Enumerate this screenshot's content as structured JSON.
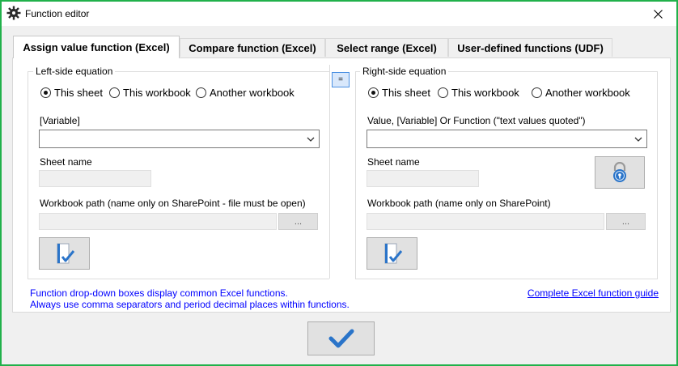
{
  "window": {
    "title": "Function editor"
  },
  "tabs": [
    {
      "label": "Assign value function (Excel)",
      "active": true
    },
    {
      "label": "Compare function (Excel)",
      "active": false
    },
    {
      "label": "Select range (Excel)",
      "active": false
    },
    {
      "label": "User-defined functions (UDF)",
      "active": false
    }
  ],
  "left": {
    "group_title": "Left-side equation",
    "scope_options": [
      {
        "label": "This sheet",
        "checked": true
      },
      {
        "label": "This workbook",
        "checked": false
      },
      {
        "label": "Another workbook",
        "checked": false
      }
    ],
    "variable_label": "[Variable]",
    "variable_value": "",
    "sheet_label": "Sheet name",
    "sheet_value": "",
    "workbook_label": "Workbook path (name only on SharePoint - file must be open)",
    "workbook_value": "",
    "browse_label": "..."
  },
  "equals_label": "=",
  "right": {
    "group_title": "Right-side equation",
    "scope_options": [
      {
        "label": "This sheet",
        "checked": true
      },
      {
        "label": "This workbook",
        "checked": false
      },
      {
        "label": "Another workbook",
        "checked": false
      }
    ],
    "value_label": "Value, [Variable] Or Function (\"text values quoted\")",
    "value_value": "",
    "sheet_label": "Sheet name",
    "sheet_value": "",
    "workbook_label": "Workbook path (name only on SharePoint)",
    "workbook_value": "",
    "browse_label": "..."
  },
  "notes": {
    "line1": "Function drop-down boxes display common Excel functions.",
    "line2": "Always use comma separators and period decimal places within functions.",
    "guide_link": "Complete Excel function guide"
  },
  "icons": {
    "title": "gear-icon",
    "close": "close-icon",
    "dropdown": "chevron-down-icon",
    "validate": "document-check-icon",
    "lock": "padlock-icon",
    "ok": "checkmark-icon"
  },
  "colors": {
    "window_border": "#21b14b",
    "link": "#0000ff",
    "equals_button_border": "#4a90e2",
    "checkmark": "#2a74c9"
  }
}
